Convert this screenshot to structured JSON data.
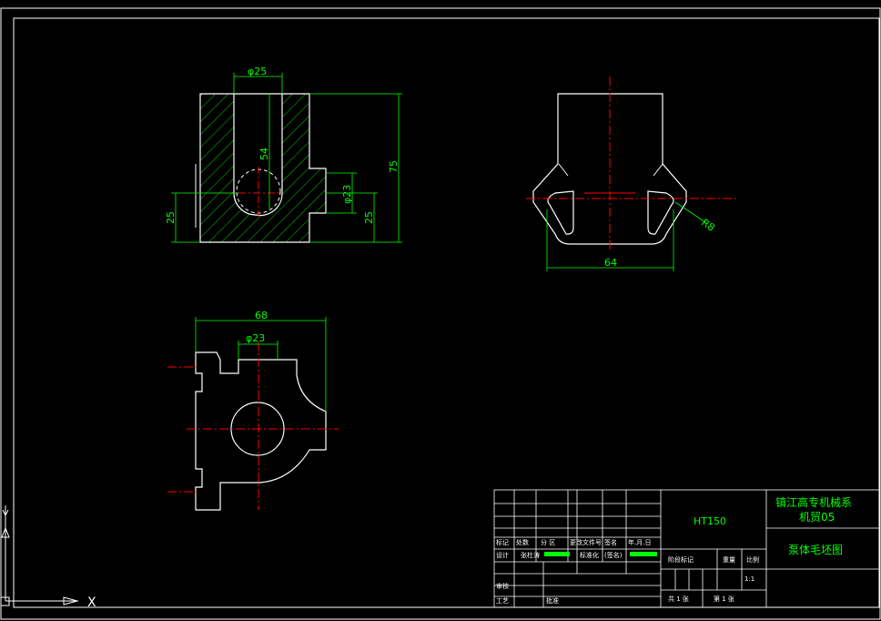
{
  "colors": {
    "background": "#000000",
    "geometry": "#ffffff",
    "dimension": "#00ff00",
    "centerline": "#ff0000",
    "hatch": "#00ff00"
  },
  "views": {
    "front": {
      "dims": {
        "bore_top": "φ25",
        "depth": "54",
        "height": "75",
        "bottom": "25",
        "right_bottom": "25",
        "bore_side": "φ23"
      }
    },
    "side": {
      "dims": {
        "width": "64",
        "radius": "R8"
      }
    },
    "top": {
      "dims": {
        "width": "68",
        "bore": "φ23"
      }
    }
  },
  "title_block": {
    "school": "镇江高专机械系",
    "class_no": "机贸05",
    "material": "HT150",
    "drawing_name": "泵体毛坯图",
    "labels": {
      "mark": "标记",
      "count": "处数",
      "zone": "分  区",
      "doc_no": "更改文件号",
      "sign": "签名",
      "date": "年.月.日",
      "design": "设计",
      "designer": "张杜涛",
      "standardize": "标准化",
      "signature": "(签名)",
      "stage": "阶段标记",
      "weight": "重量",
      "scale": "比例",
      "scale_value": "1:1",
      "review": "审核",
      "process": "工艺",
      "approve": "批准",
      "sheets": "共 1 张",
      "sheet": "第 1 张"
    }
  },
  "ucs": {
    "y_label": "Y",
    "x_label": "X"
  }
}
